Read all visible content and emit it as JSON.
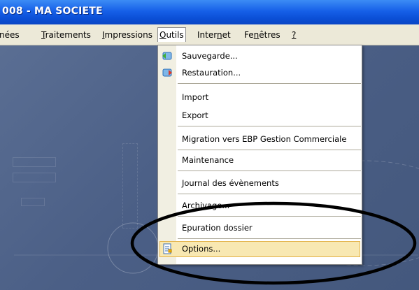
{
  "titlebar": {
    "title": "008 - MA SOCIETE"
  },
  "menubar": {
    "items": [
      {
        "label": "nées"
      },
      {
        "label": "Traitements",
        "u": "T"
      },
      {
        "label": "Impressions",
        "u": "I"
      },
      {
        "label": "Outils",
        "u": "O"
      },
      {
        "label": "Internet"
      },
      {
        "label": "Fenêtres"
      },
      {
        "label": "?"
      }
    ]
  },
  "menu": {
    "items": [
      {
        "label": "Sauvegarde..."
      },
      {
        "label": "Restauration..."
      },
      {
        "label": "Import"
      },
      {
        "label": "Export"
      },
      {
        "label": "Migration vers EBP Gestion Commerciale"
      },
      {
        "label": "Maintenance"
      },
      {
        "label": "Journal des évènements"
      },
      {
        "label": "Archivage..."
      },
      {
        "label": "Epuration dossier"
      },
      {
        "label": "Options..."
      }
    ]
  },
  "colors": {
    "titlebar": "#0b4fd6",
    "menubar": "#ece9d8",
    "highlight": "#f8e8b2",
    "highlight_border": "#e3b34a",
    "annotation": "#000000"
  }
}
